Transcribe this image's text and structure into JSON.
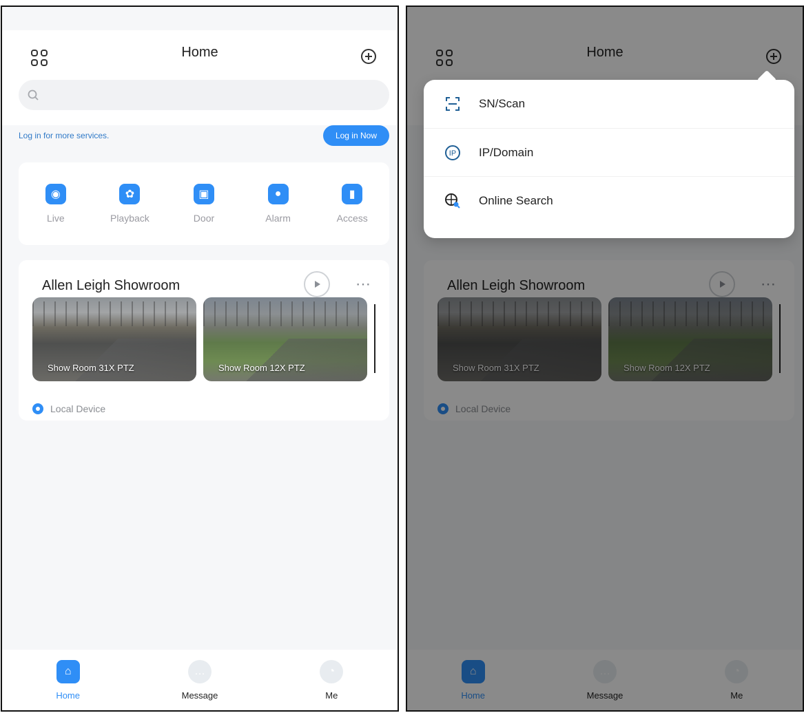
{
  "left": {
    "title": "Home",
    "login": {
      "prompt": "Log in for more services.",
      "button": "Log in Now"
    },
    "quick_actions": [
      {
        "label": "Live",
        "icon": "camera-icon"
      },
      {
        "label": "Playback",
        "icon": "film-reel-icon"
      },
      {
        "label": "Door",
        "icon": "door-phone-icon"
      },
      {
        "label": "Alarm",
        "icon": "alarm-icon"
      },
      {
        "label": "Access",
        "icon": "access-card-icon"
      }
    ],
    "site": {
      "name": "Allen Leigh Showroom",
      "cameras": [
        {
          "label": "Show Room 31X PTZ"
        },
        {
          "label": "Show Room 12X PTZ"
        }
      ],
      "local_label": "Local Device"
    },
    "tabs": [
      {
        "label": "Home",
        "icon": "home-icon"
      },
      {
        "label": "Message",
        "icon": "message-icon"
      },
      {
        "label": "Me",
        "icon": "me-icon"
      }
    ]
  },
  "right": {
    "title": "Home",
    "popup_items": [
      {
        "label": "SN/Scan",
        "icon": "scan-icon"
      },
      {
        "label": "IP/Domain",
        "icon": "ip-icon"
      },
      {
        "label": "Online Search",
        "icon": "globe-search-icon"
      }
    ]
  }
}
